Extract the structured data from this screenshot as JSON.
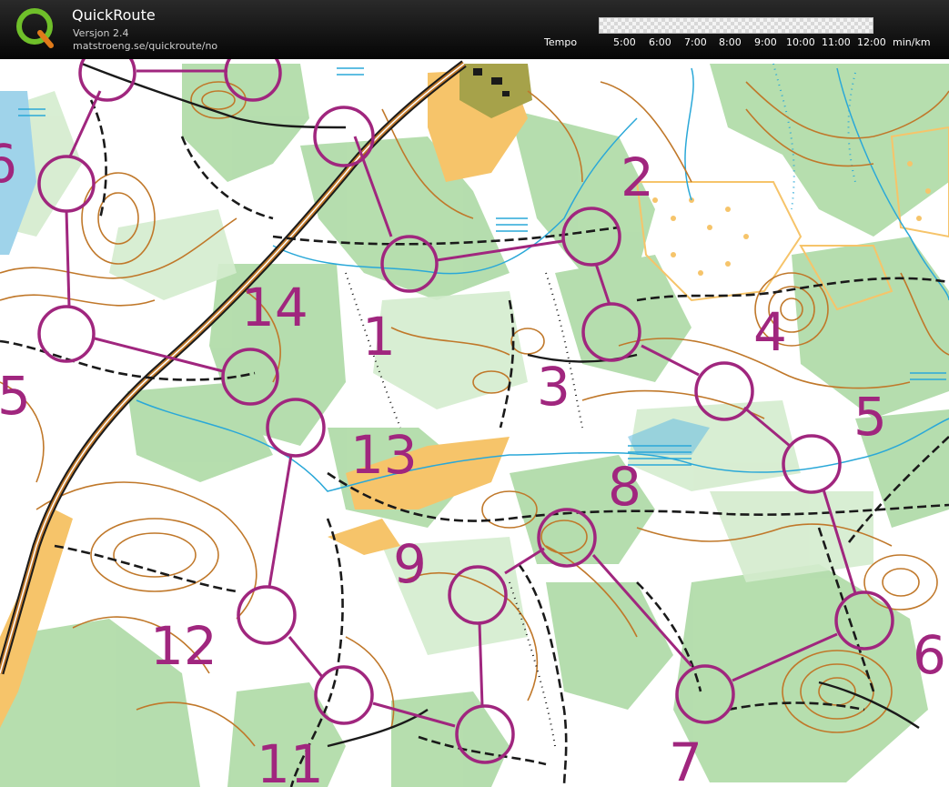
{
  "app": {
    "title": "QuickRoute",
    "version": "Versjon 2.4",
    "url": "matstroeng.se/quickroute/no"
  },
  "tempo": {
    "label": "Tempo",
    "ticks": [
      "5:00",
      "6:00",
      "7:00",
      "8:00",
      "9:00",
      "10:00",
      "11:00",
      "12:00"
    ],
    "unit": "min/km"
  },
  "colors": {
    "course": "#a0267e",
    "vegetation": "#a9d8a0",
    "contour": "#c0782a",
    "open_land": "#f6c46a",
    "water": "#2aa8d8",
    "track": "#1a1a1a"
  },
  "course": {
    "labels": [
      "1",
      "2",
      "3",
      "4",
      "5",
      "6",
      "7",
      "8",
      "9",
      "11",
      "12",
      "13",
      "14",
      "5",
      "6"
    ]
  }
}
